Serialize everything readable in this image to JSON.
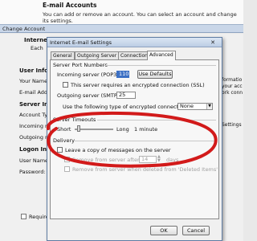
{
  "header": {
    "title": "E-mail Accounts",
    "subtitle": "You can add or remove an account. You can select an account and change its settings."
  },
  "back_window": {
    "title": "Change Account",
    "heading": "Internet",
    "heading_sub": "Each",
    "left_labels": [
      "User Info",
      "Your Name:",
      "E-mail Addr",
      "Server In",
      "Account Ty",
      "Incoming m",
      "Outgoing m",
      "Logon Inf",
      "User Name",
      "Password:",
      "Require"
    ],
    "right_labels": [
      "formatio",
      "your acc",
      "ork conn",
      "Settings"
    ]
  },
  "dialog": {
    "title": "Internet E-mail Settings",
    "close_glyph": "✕",
    "tabs": [
      "General",
      "Outgoing Server",
      "Connection",
      "Advanced"
    ],
    "active_tab": "Advanced",
    "server_ports": {
      "heading": "Server Port Numbers",
      "incoming_label": "Incoming server (POP3):",
      "incoming_value": "110",
      "use_defaults": "Use Defaults",
      "ssl_label": "This server requires an encrypted connection (SSL)",
      "outgoing_label": "Outgoing server (SMTP):",
      "outgoing_value": "25",
      "encryption_label": "Use the following type of encrypted connection:",
      "encryption_value": "None"
    },
    "timeouts": {
      "heading": "Server Timeouts",
      "short": "Short",
      "long": "Long",
      "value": "1 minute"
    },
    "delivery": {
      "heading": "Delivery",
      "leave_copy": "Leave a copy of messages on the server",
      "remove_after": "Remove from server after",
      "days_value": "14",
      "days_unit": "days",
      "remove_deleted": "Remove from server when deleted from 'Deleted Items'"
    },
    "buttons": {
      "ok": "OK",
      "cancel": "Cancel"
    }
  },
  "colors": {
    "annotation": "#d21a1a",
    "selection": "#3b6fc4"
  }
}
